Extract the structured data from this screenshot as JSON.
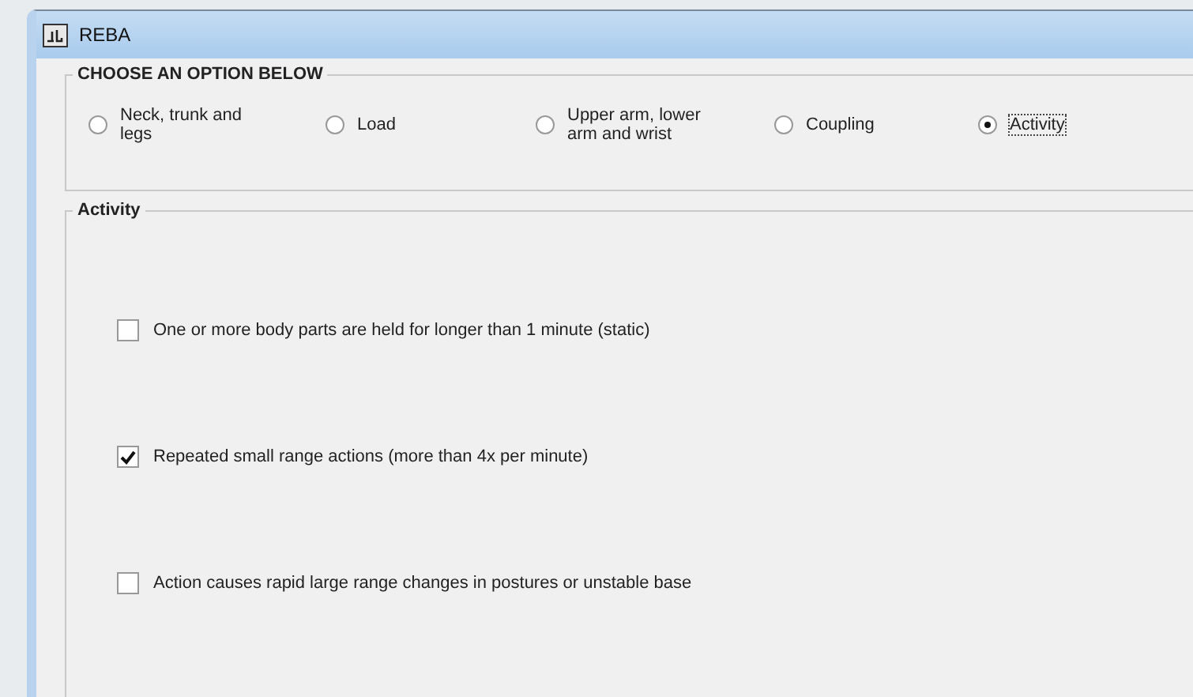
{
  "window": {
    "title": "REBA"
  },
  "options": {
    "title": "CHOOSE AN OPTION BELOW",
    "items": [
      {
        "label": "Neck, trunk and legs",
        "selected": false
      },
      {
        "label": "Load",
        "selected": false
      },
      {
        "label": "Upper arm, lower arm and wrist",
        "selected": false
      },
      {
        "label": "Coupling",
        "selected": false
      },
      {
        "label": "Activity",
        "selected": true
      }
    ]
  },
  "activity": {
    "title": "Activity",
    "items": [
      {
        "label": "One or more body parts are held for longer than 1 minute (static)",
        "checked": false
      },
      {
        "label": "Repeated small range actions (more than 4x per minute)",
        "checked": true
      },
      {
        "label": "Action causes rapid large range changes in postures or unstable base",
        "checked": false
      }
    ]
  }
}
